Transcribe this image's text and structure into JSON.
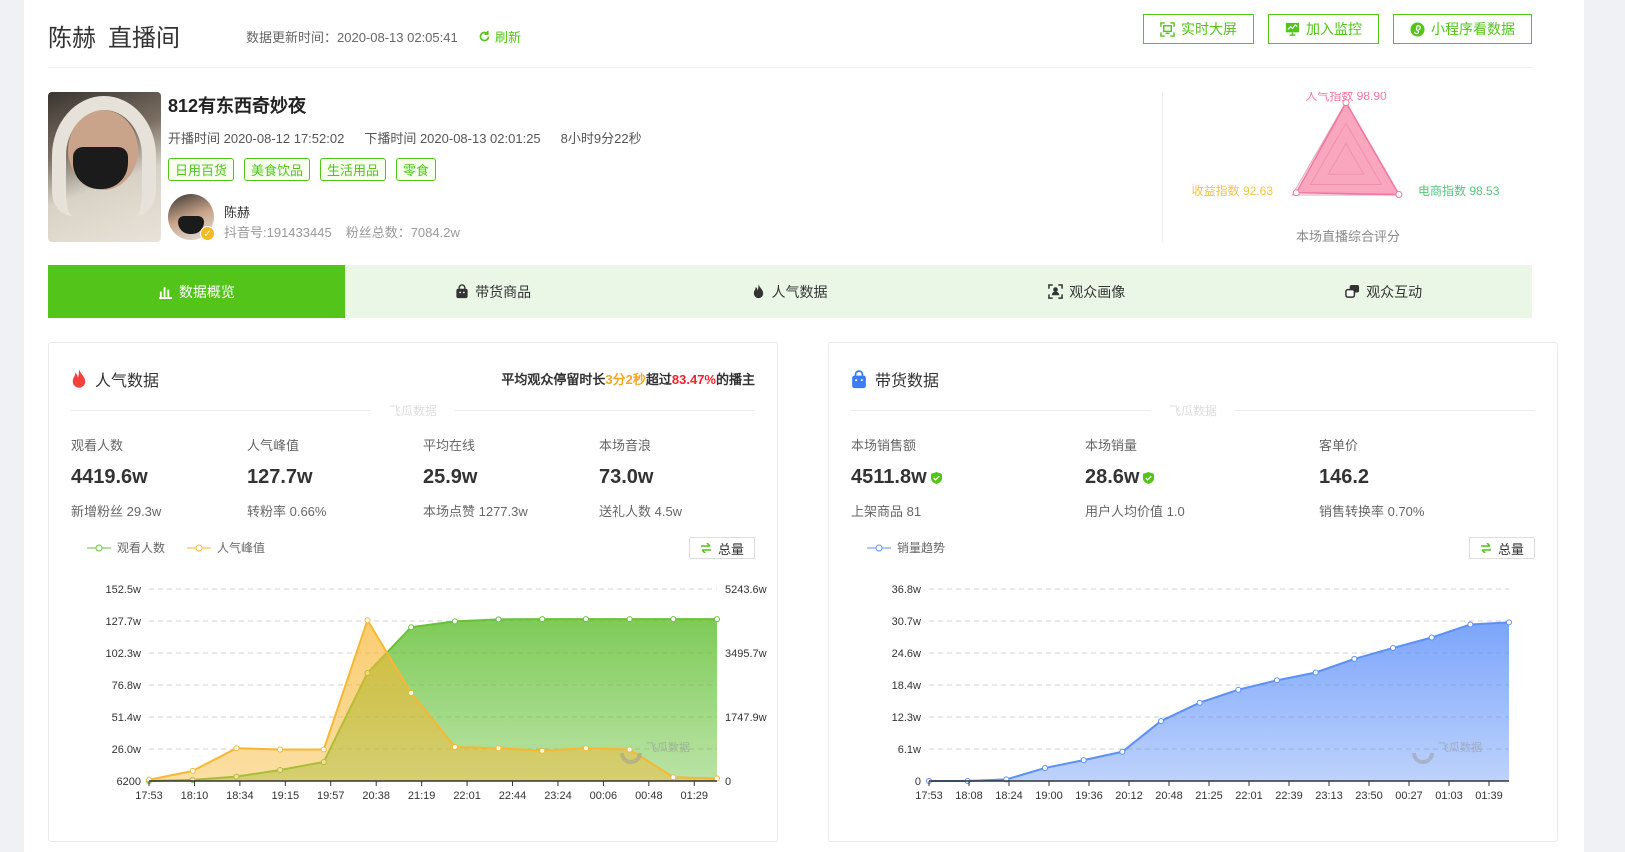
{
  "header": {
    "title_name": "陈赫",
    "title_suffix": "直播间",
    "update_label": "数据更新时间：2020-08-13 02:05:41",
    "refresh_label": "刷新",
    "buttons": [
      {
        "label": "实时大屏",
        "icon": "fullscreen-icon"
      },
      {
        "label": "加入监控",
        "icon": "monitor-icon"
      },
      {
        "label": "小程序看数据",
        "icon": "mini-program-icon"
      }
    ]
  },
  "live": {
    "title": "812有东西奇妙夜",
    "start_time": "开播时间 2020-08-12 17:52:02",
    "end_time": "下播时间 2020-08-13 02:01:25",
    "duration": "8小时9分22秒",
    "tags": [
      "日用百货",
      "美食饮品",
      "生活用品",
      "零食"
    ],
    "anchor": {
      "name": "陈赫",
      "douyin_id": "抖音号:191433445",
      "fans": "粉丝总数：7084.2w"
    }
  },
  "score": {
    "title": "本场直播综合评分",
    "indices": [
      {
        "label": "人气指数 98.90",
        "name": "人气指数",
        "value": 98.9,
        "color": "#f2779e"
      },
      {
        "label": "电商指数 98.53",
        "name": "电商指数",
        "value": 98.53,
        "color": "#52c878"
      },
      {
        "label": "收益指数 92.63",
        "name": "收益指数",
        "value": 92.63,
        "color": "#f5c342"
      }
    ]
  },
  "nav": {
    "tabs": [
      {
        "label": "数据概览",
        "icon": "bar-chart-icon",
        "active": true
      },
      {
        "label": "带货商品",
        "icon": "shopping-bag-icon",
        "active": false
      },
      {
        "label": "人气数据",
        "icon": "flame-icon",
        "active": false
      },
      {
        "label": "观众画像",
        "icon": "portrait-icon",
        "active": false
      },
      {
        "label": "观众互动",
        "icon": "interaction-icon",
        "active": false
      }
    ]
  },
  "popularity": {
    "title": "人气数据",
    "stay_prefix": "平均观众停留时长",
    "stay_time": "3分2秒",
    "stay_mid": "超过",
    "stay_pct": "83.47%",
    "stay_suffix": "的播主",
    "watermark": "飞瓜数据",
    "stats": [
      {
        "label": "观看人数",
        "value": "4419.6w",
        "sub": "新增粉丝 29.3w"
      },
      {
        "label": "人气峰值",
        "value": "127.7w",
        "sub": "转粉率 0.66%"
      },
      {
        "label": "平均在线",
        "value": "25.9w",
        "sub": "本场点赞 1277.3w"
      },
      {
        "label": "本场音浪",
        "value": "73.0w",
        "sub": "送礼人数 4.5w"
      }
    ],
    "toggle_label": "总量"
  },
  "sales": {
    "title": "带货数据",
    "watermark": "飞瓜数据",
    "stats": [
      {
        "label": "本场销售额",
        "value": "4511.8w",
        "sub": "上架商品 81",
        "verified": true
      },
      {
        "label": "本场销量",
        "value": "28.6w",
        "sub": "用户人均价值 1.0",
        "verified": true
      },
      {
        "label": "客单价",
        "value": "146.2",
        "sub": "销售转换率 0.70%",
        "verified": false
      }
    ],
    "toggle_label": "总量"
  },
  "chart_data": [
    {
      "type": "area",
      "title": "人气数据",
      "x": [
        "17:53",
        "18:10",
        "18:34",
        "19:15",
        "19:57",
        "20:38",
        "21:19",
        "22:01",
        "22:44",
        "23:24",
        "00:06",
        "00:48",
        "01:29"
      ],
      "y_left_ticks": [
        "6200",
        "26.0w",
        "51.4w",
        "76.8w",
        "102.3w",
        "127.7w",
        "152.5w"
      ],
      "y_right_ticks": [
        "0",
        "1747.9w",
        "3495.7w",
        "5243.6w"
      ],
      "y_left_range": [
        0.62,
        152.5
      ],
      "y_right_range": [
        0,
        5243.6
      ],
      "grid": true,
      "legend_position": "top-left",
      "series": [
        {
          "name": "观看人数",
          "axis": "right",
          "color": "#67c23a",
          "unit": "w",
          "values": [
            0,
            30,
            120,
            300,
            520,
            2950,
            4200,
            4360,
            4415,
            4419.6,
            4419.6,
            4419.6,
            4419.6,
            4419.6
          ]
        },
        {
          "name": "人气峰值",
          "axis": "left",
          "color": "#f7b733",
          "unit": "w",
          "values": [
            1,
            8,
            26,
            25,
            25,
            127.7,
            70,
            27,
            26,
            24,
            26,
            25,
            3,
            2
          ]
        }
      ]
    },
    {
      "type": "area",
      "title": "带货数据",
      "x": [
        "17:53",
        "18:08",
        "18:24",
        "19:00",
        "19:36",
        "20:12",
        "20:48",
        "21:25",
        "22:01",
        "22:39",
        "23:13",
        "23:50",
        "00:27",
        "01:03",
        "01:39"
      ],
      "y_ticks": [
        "0",
        "6.1w",
        "12.3w",
        "18.4w",
        "24.6w",
        "30.7w",
        "36.8w"
      ],
      "y_range": [
        0,
        36.8
      ],
      "grid": true,
      "legend_position": "top-left",
      "series": [
        {
          "name": "销量趋势",
          "color": "#5b8ff9",
          "unit": "w",
          "values": [
            0,
            0,
            0.3,
            2.5,
            4.0,
            5.6,
            11.5,
            15.0,
            17.5,
            19.3,
            20.8,
            23.4,
            25.5,
            27.5,
            30.0,
            30.4
          ]
        }
      ]
    }
  ]
}
